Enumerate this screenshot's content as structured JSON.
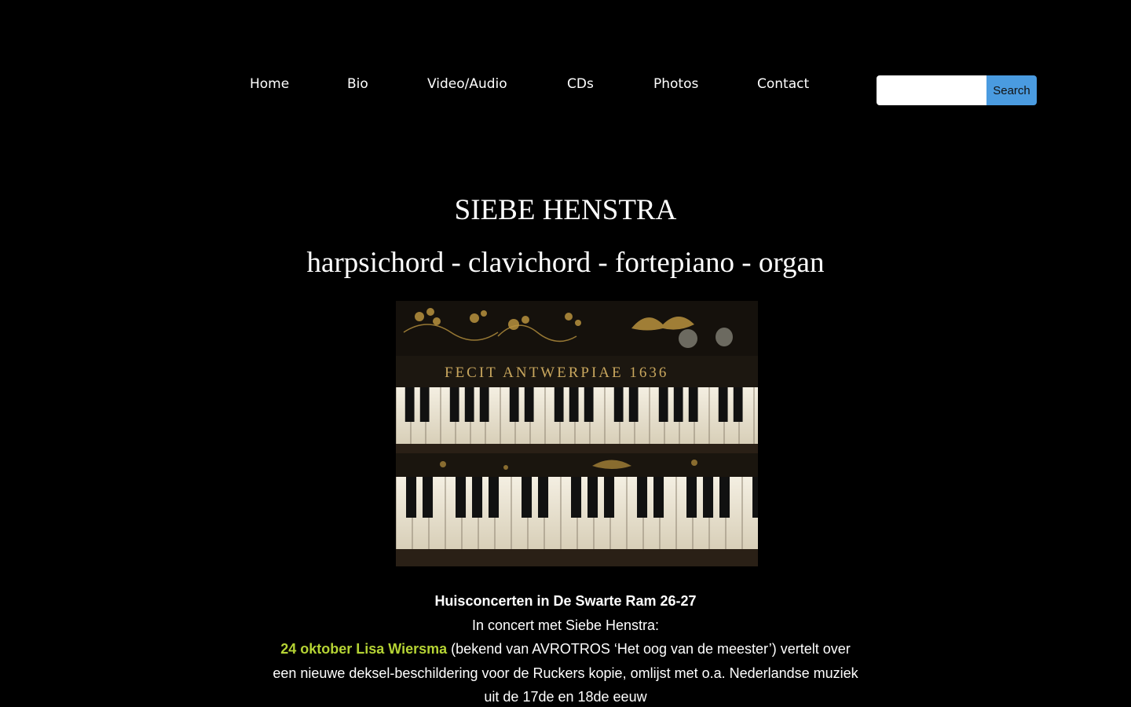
{
  "nav": {
    "items": [
      {
        "label": "Home"
      },
      {
        "label": "Bio"
      },
      {
        "label": "Video/Audio"
      },
      {
        "label": "CDs"
      },
      {
        "label": "Photos"
      },
      {
        "label": "Contact"
      }
    ]
  },
  "search": {
    "placeholder": "",
    "value": "",
    "button_label": "Search",
    "button_color": "#4a9be0"
  },
  "header": {
    "title": "SIEBE HENSTRA",
    "subtitle": "harpsichord - clavichord - fortepiano - organ"
  },
  "hero_image": {
    "inscription": "FECIT ANTWERPIAE 1636"
  },
  "announcement": {
    "title": "Huisconcerten in De Swarte Ram 26-27",
    "intro": "In concert met Siebe Henstra:",
    "event_highlight": "24 oktober Lisa Wiersma",
    "event_text_1": " (bekend van AVROTROS ‘Het oog van de meester’) vertelt over",
    "event_text_2": "een nieuwe deksel-beschildering voor de Ruckers kopie, omlijst met o.a. Nederlandse muziek",
    "event_text_3": "uit de 17de en 18de eeuw",
    "highlight_color": "#b5d334"
  }
}
